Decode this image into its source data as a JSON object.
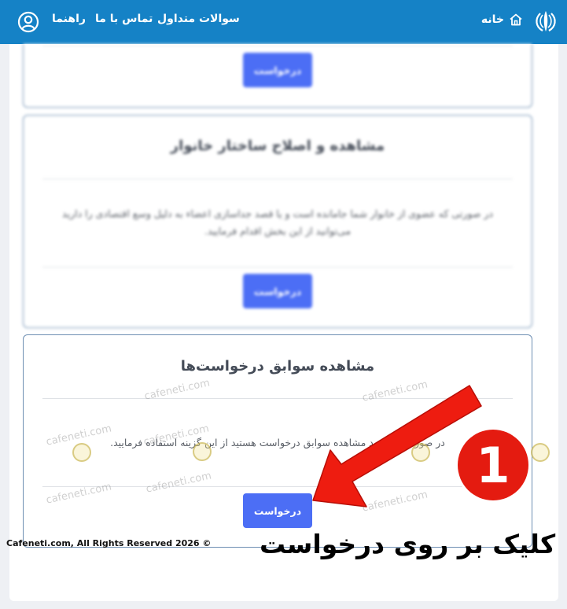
{
  "header": {
    "home_label": "خانه",
    "nav": {
      "faq": "سوالات متداول",
      "contact": "تماس با ما",
      "guide": "راهنما"
    }
  },
  "cards": [
    {
      "button_label": "درخواست"
    },
    {
      "title": "مشاهده و اصلاح ساختار خانوار",
      "description": "در صورتی که عضوی از خانوار شما جامانده است و یا قصد جداسازی اعضاء به دلیل وسع اقتصادی را دارید می‌توانید از این بخش اقدام فرمایید.",
      "button_label": "درخواست"
    },
    {
      "title": "مشاهده سوابق درخواست‌ها",
      "description": "در صورتی که قصد مشاهده سوابق درخواست هستید از این گزینه استفاده فرمایید.",
      "button_label": "درخواست"
    }
  ],
  "annotation": {
    "step_number": "1",
    "caption": "کلیک بر روی درخواست"
  },
  "watermark": "cafeneti.com",
  "footer": {
    "copyright": "Cafeneti.com, All Rights Reserved 2026 ©"
  },
  "colors": {
    "header_bg": "#1582c6",
    "button_bg": "#4c6ef5",
    "arrow": "#ee1c10",
    "card_border": "#6e8fb3"
  }
}
